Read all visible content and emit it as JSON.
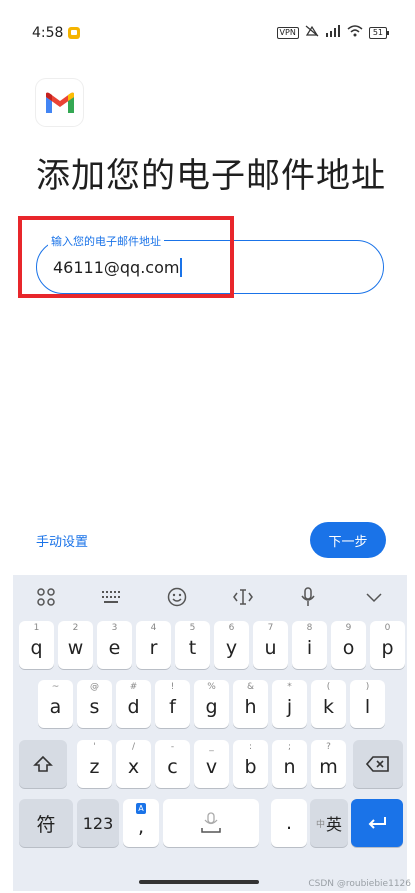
{
  "status_bar": {
    "time": "4:58",
    "vpn": "VPN",
    "signal": "⁴⁶ᴵıl",
    "battery": "51"
  },
  "page": {
    "title": "添加您的电子邮件地址"
  },
  "email_input": {
    "label": "输入您的电子邮件地址",
    "value": "46111@qq.com"
  },
  "actions": {
    "manual_setup": "手动设置",
    "next": "下一步"
  },
  "keyboard": {
    "toolbar_icons": [
      "grid-icon",
      "keyboard-icon",
      "emoji-icon",
      "cursor-icon",
      "mic-icon",
      "collapse-icon"
    ],
    "row1": [
      {
        "k": "q",
        "s": "1"
      },
      {
        "k": "w",
        "s": "2"
      },
      {
        "k": "e",
        "s": "3"
      },
      {
        "k": "r",
        "s": "4"
      },
      {
        "k": "t",
        "s": "5"
      },
      {
        "k": "y",
        "s": "6"
      },
      {
        "k": "u",
        "s": "7"
      },
      {
        "k": "i",
        "s": "8"
      },
      {
        "k": "o",
        "s": "9"
      },
      {
        "k": "p",
        "s": "0"
      }
    ],
    "row2": [
      {
        "k": "a",
        "s": "~"
      },
      {
        "k": "s",
        "s": "@"
      },
      {
        "k": "d",
        "s": "#"
      },
      {
        "k": "f",
        "s": "!"
      },
      {
        "k": "g",
        "s": "%"
      },
      {
        "k": "h",
        "s": "&"
      },
      {
        "k": "j",
        "s": "*"
      },
      {
        "k": "k",
        "s": "("
      },
      {
        "k": "l",
        "s": ")"
      }
    ],
    "row3": [
      {
        "k": "z",
        "s": "'"
      },
      {
        "k": "x",
        "s": "/"
      },
      {
        "k": "c",
        "s": "-"
      },
      {
        "k": "v",
        "s": "_"
      },
      {
        "k": "b",
        "s": ":"
      },
      {
        "k": "n",
        "s": ";"
      },
      {
        "k": "m",
        "s": "?"
      }
    ],
    "symbols_key": "符",
    "numbers_key": "123",
    "comma_key": ",",
    "comma_badge": "A",
    "period_key": ".",
    "lang_key_small": "中",
    "lang_key": "英"
  },
  "watermark": "CSDN @roubiebie1126"
}
